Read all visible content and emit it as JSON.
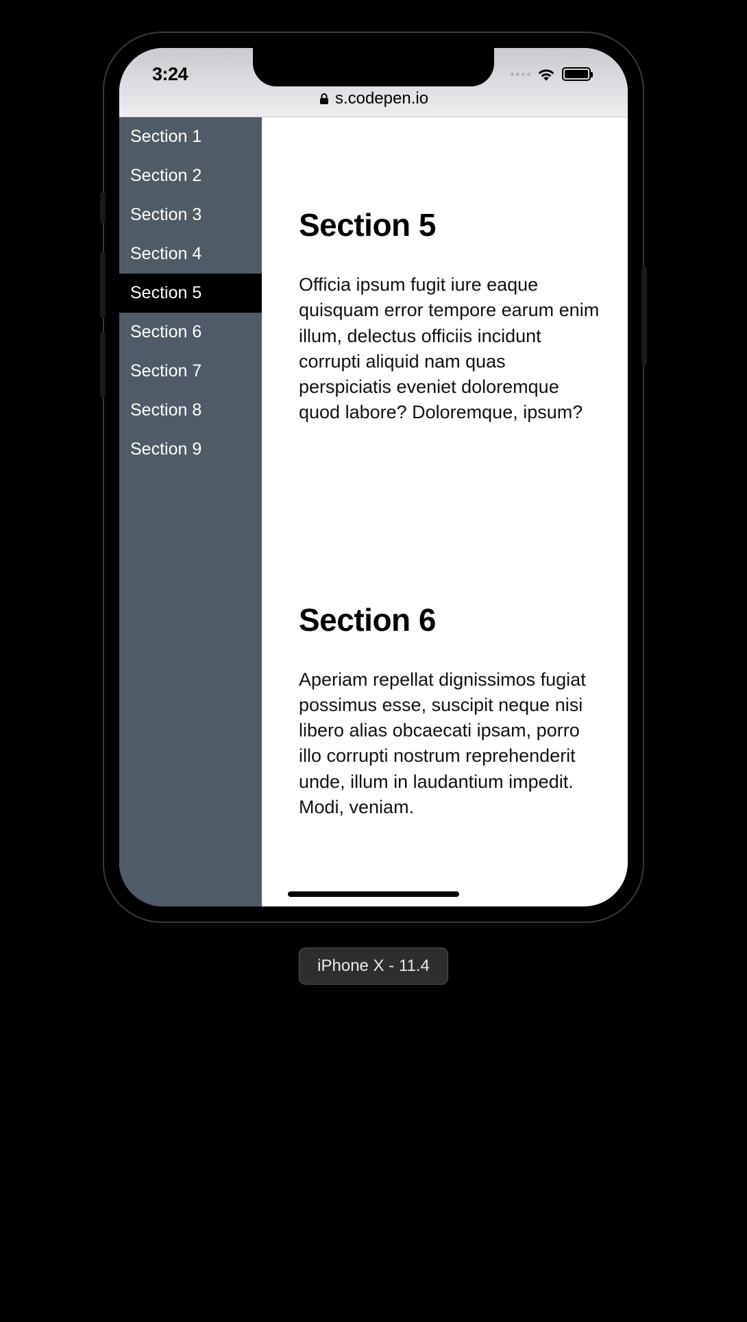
{
  "statusbar": {
    "time": "3:24",
    "url_host": "s.codepen.io"
  },
  "sidebar": {
    "active_index": 4,
    "items": [
      {
        "label": "Section 1"
      },
      {
        "label": "Section 2"
      },
      {
        "label": "Section 3"
      },
      {
        "label": "Section 4"
      },
      {
        "label": "Section 5"
      },
      {
        "label": "Section 6"
      },
      {
        "label": "Section 7"
      },
      {
        "label": "Section 8"
      },
      {
        "label": "Section 9"
      }
    ]
  },
  "main": {
    "sections": [
      {
        "title": "Section 5",
        "body": "Officia ipsum fugit iure eaque quisquam error tempore earum enim illum, delectus officiis incidunt corrupti aliquid nam quas perspiciatis eveniet doloremque quod labore? Doloremque, ipsum?"
      },
      {
        "title": "Section 6",
        "body": "Aperiam repellat dignissimos fugiat possimus esse, suscipit neque nisi libero alias obcaecati ipsam, porro illo corrupti nostrum reprehenderit unde, illum in laudantium impedit. Modi, veniam."
      }
    ]
  },
  "device_label": "iPhone X - 11.4"
}
